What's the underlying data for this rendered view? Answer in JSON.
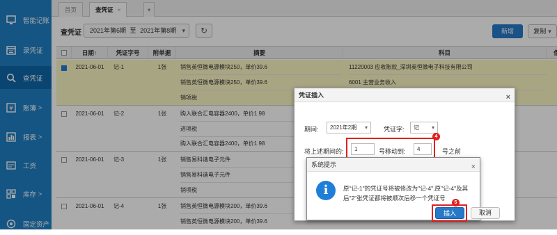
{
  "sidebar": {
    "items": [
      {
        "label": "智能记账",
        "icon": "monitor-icon",
        "chevron": ""
      },
      {
        "label": "录凭证",
        "icon": "calendar-icon",
        "chevron": ""
      },
      {
        "label": "查凭证",
        "icon": "search-icon",
        "chevron": ""
      },
      {
        "label": "账簿",
        "icon": "yen-icon",
        "chevron": ">"
      },
      {
        "label": "报表",
        "icon": "report-icon",
        "chevron": ">"
      },
      {
        "label": "工资",
        "icon": "salary-icon",
        "chevron": ""
      },
      {
        "label": "库存",
        "icon": "inventory-icon",
        "chevron": ">"
      },
      {
        "label": "固定资产",
        "icon": "asset-icon",
        "chevron": ""
      }
    ]
  },
  "tabs": [
    {
      "label": "首页"
    },
    {
      "label": "查凭证",
      "close": "×"
    },
    {
      "label": "▾"
    }
  ],
  "toolbar": {
    "title": "查凭证",
    "period_from": "2021年第6期",
    "period_sep": "至",
    "period_to": "2021年第8期",
    "caret": "▾",
    "refresh": "↻",
    "add": "新增",
    "copy": "复制",
    "copy_caret": "▾"
  },
  "table": {
    "headers": [
      "日期",
      "凭证字号",
      "附单据",
      "摘要",
      "科目",
      "借"
    ],
    "sort_arrow": "↑",
    "rows": [
      {
        "date": "2021-06-01",
        "no": "记-1",
        "att": "1张",
        "lines": [
          {
            "summary": "销售英恒微电源模块250，单价39.6",
            "account": "11220003 应收账款_深圳英恒微电子科技有限公司"
          },
          {
            "summary": "销售英恒微电源模块250，单价39.6",
            "account": "6001 主营业务收入"
          },
          {
            "summary": "销项税",
            "account": ""
          }
        ]
      },
      {
        "date": "2021-06-01",
        "no": "记-2",
        "att": "1张",
        "lines": [
          {
            "summary": "购入联合汇电容器2400，单价1.98",
            "account": ""
          },
          {
            "summary": "进项税",
            "account": ""
          },
          {
            "summary": "购入联合汇电容器2400，单价1.98",
            "account": ""
          }
        ]
      },
      {
        "date": "2021-06-01",
        "no": "记-3",
        "att": "1张",
        "lines": [
          {
            "summary": "销售易科谐电子元件",
            "account": ""
          },
          {
            "summary": "销售易科谐电子元件",
            "account": ""
          },
          {
            "summary": "销项税",
            "account": ""
          }
        ]
      },
      {
        "date": "2021-06-01",
        "no": "记-4",
        "att": "1张",
        "lines": [
          {
            "summary": "销售英恒微电源模块200，单价39.6",
            "account": ""
          },
          {
            "summary": "销售英恒微电源模块200，单价39.6",
            "account": ""
          }
        ]
      }
    ]
  },
  "dialog": {
    "title": "凭证插入",
    "close": "×",
    "period_label": "期间:",
    "period_value": "2021年2期",
    "voucher_label": "凭证字:",
    "voucher_value": "记",
    "caret": "▾",
    "move_prefix": "将上述期间的:",
    "move_from": "1",
    "move_mid": "号移动到:",
    "move_to": "4",
    "move_suffix": "号之前",
    "insert": "插入",
    "cancel": "取消"
  },
  "alert": {
    "title": "系统提示",
    "close": "×",
    "icon": "info-icon",
    "glyph": "i",
    "line1": "原\"记-1\"的凭证号将被修改为\"记-4\",原\"记-4\"及其",
    "line2": "后\"2\"张凭证都将被顺次后移一个凭证号"
  },
  "markers": {
    "four": "4",
    "five": "5"
  },
  "colors": {
    "sidebar": "#1f7fc4",
    "selected_row": "#fbf7c4",
    "primary": "#2779c8",
    "highlight": "#e02020"
  }
}
